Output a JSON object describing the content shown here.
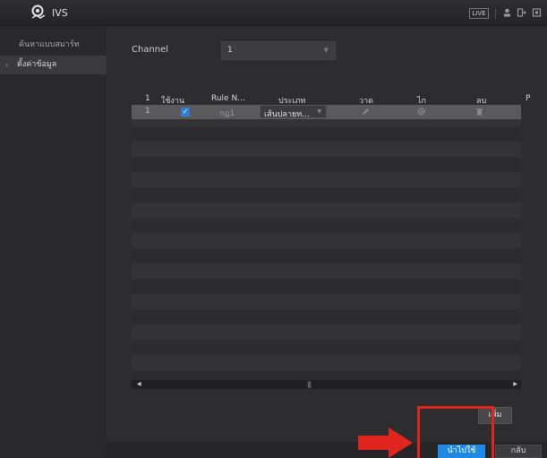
{
  "titlebar": {
    "title": "IVS",
    "live_label": "LIVE",
    "icons": [
      "user-icon",
      "logout-icon",
      "fullscreen-icon"
    ]
  },
  "sidebar": {
    "items": [
      {
        "label": "ค้นหาแบบสมาร์ท",
        "active": false
      },
      {
        "label": "ตั้งค่าข้อมูล",
        "active": true,
        "arrow": "›"
      }
    ]
  },
  "main": {
    "channel_label": "Channel",
    "channel_value": "1"
  },
  "rule_table": {
    "columns": [
      "1",
      "ใช้งาน",
      "Rule N...",
      "ประเภท",
      "วาด",
      "ไก",
      "ลบ",
      "P"
    ],
    "rows": [
      {
        "index": "1",
        "enabled": true,
        "rule_name": "กฎ1",
        "type": "เส้นปลายท...",
        "draw_icon": "pencil-icon",
        "trigger_icon": "gear-icon",
        "delete_icon": "trash-icon"
      }
    ]
  },
  "buttons": {
    "add": "เพิ่ม",
    "apply": "นำไปใช้",
    "back": "กลับ"
  },
  "colors": {
    "accent": "#1f8ae3",
    "highlight": "#e0251f",
    "checkbox": "#2f7fd6"
  }
}
